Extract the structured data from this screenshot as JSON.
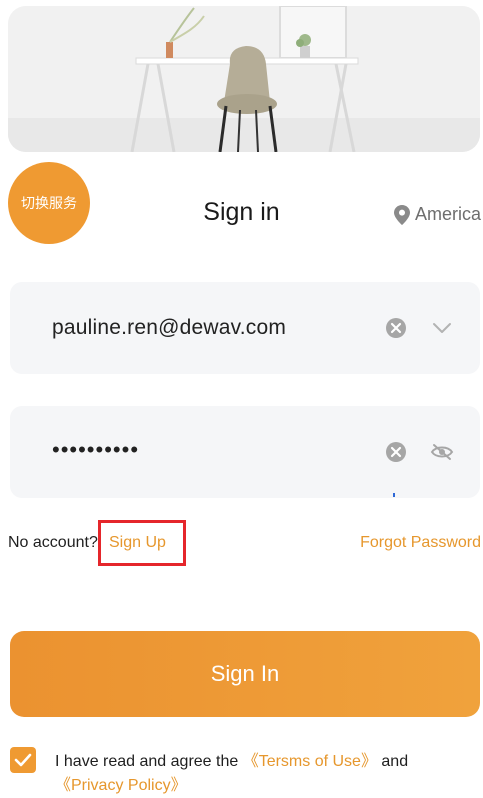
{
  "service_switch": {
    "label": "切换服务"
  },
  "header": {
    "title": "Sign in"
  },
  "region": {
    "label": "America",
    "icon": "location-pin-icon"
  },
  "email": {
    "value": "pauline.ren@dewav.com"
  },
  "password": {
    "value": "••••••••••"
  },
  "links": {
    "no_account": "No account?",
    "sign_up": "Sign Up",
    "forgot_password": "Forgot Password"
  },
  "primary": {
    "label": "Sign In"
  },
  "agreement": {
    "checked": true,
    "text": "I have read and agree the",
    "terms": "《Tersms of Use》",
    "and": "and",
    "privacy": "《Privacy Policy》"
  },
  "colors": {
    "accent": "#ef9a32",
    "link": "#e6972d",
    "highlight": "#e5262b",
    "field_bg": "#f5f6f8"
  }
}
